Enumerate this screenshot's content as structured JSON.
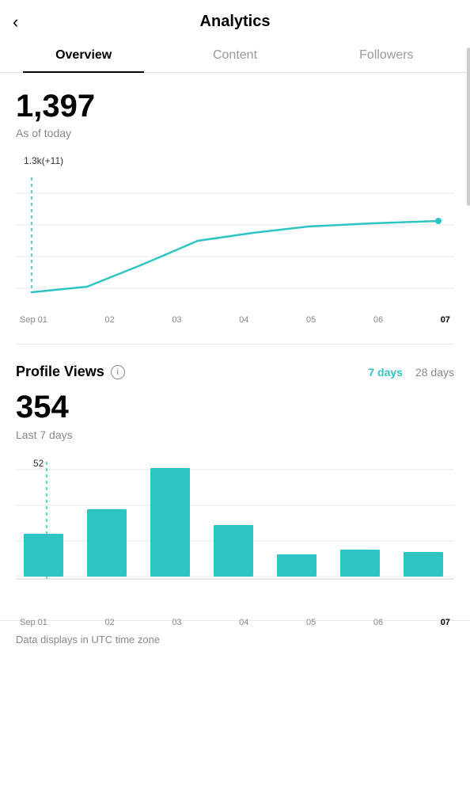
{
  "header": {
    "back_icon": "‹",
    "title": "Analytics"
  },
  "tabs": [
    {
      "id": "overview",
      "label": "Overview",
      "active": true
    },
    {
      "id": "content",
      "label": "Content",
      "active": false
    },
    {
      "id": "followers",
      "label": "Followers",
      "active": false
    }
  ],
  "followers_section": {
    "count": "1,397",
    "sublabel": "As of today",
    "chart_annotation": "1.3k(+11)",
    "x_labels": [
      {
        "text": "Sep 01",
        "bold": false
      },
      {
        "text": "02",
        "bold": false
      },
      {
        "text": "03",
        "bold": false
      },
      {
        "text": "04",
        "bold": false
      },
      {
        "text": "05",
        "bold": false
      },
      {
        "text": "06",
        "bold": false
      },
      {
        "text": "07",
        "bold": true
      }
    ]
  },
  "profile_views_section": {
    "title": "Profile Views",
    "info_icon": "i",
    "period_7": "7 days",
    "period_28": "28 days",
    "count": "354",
    "sublabel": "Last 7 days",
    "chart_annotation": "52",
    "bar_data": [
      {
        "label": "Sep 01",
        "value": 35,
        "bold": false
      },
      {
        "label": "02",
        "value": 55,
        "bold": false
      },
      {
        "label": "03",
        "value": 90,
        "bold": false
      },
      {
        "label": "04",
        "value": 42,
        "bold": false
      },
      {
        "label": "05",
        "value": 18,
        "bold": false
      },
      {
        "label": "06",
        "value": 22,
        "bold": false
      },
      {
        "label": "07",
        "value": 20,
        "bold": true
      }
    ],
    "bar_max": 100
  },
  "footer": {
    "note": "Data displays in UTC time zone"
  },
  "colors": {
    "accent": "#2ec4c4",
    "active_tab_underline": "#000000",
    "bar_color": "#2ec4c4",
    "grid_line": "#e8e8e8",
    "dashed_line": "#2ec4c4"
  }
}
